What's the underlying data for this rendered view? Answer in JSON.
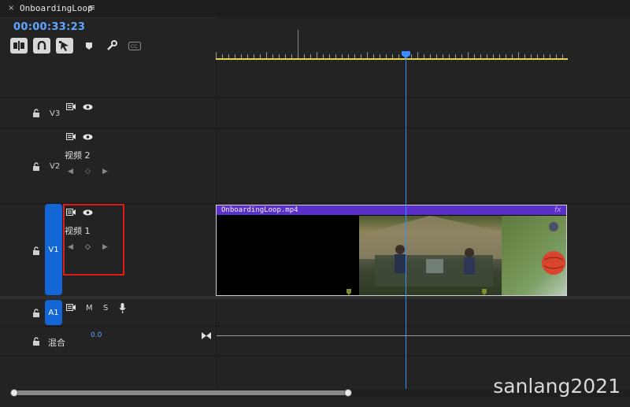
{
  "window": {
    "close_glyph": "×",
    "sequence_name": "OnboardingLoop",
    "menu_glyph": "≡"
  },
  "timecode": "00:00:33:23",
  "toolbar": {
    "buttons": [
      "insert-sequence-as-nest",
      "snap",
      "linked-selection"
    ],
    "icons": [
      "marker-icon",
      "wrench-icon",
      "captions-icon"
    ]
  },
  "tracks": {
    "v3": {
      "label": "V3"
    },
    "v2": {
      "label": "V2",
      "name": "视频 2"
    },
    "v1": {
      "label": "V1",
      "name": "视频 1"
    },
    "a1": {
      "label": "A1",
      "mute": "M",
      "solo": "S"
    },
    "mix": {
      "label": "混合",
      "volume": "0.0"
    }
  },
  "keyframe_nav": {
    "prev": "◀",
    "add": "◇",
    "next": "▶"
  },
  "clip": {
    "name": "OnboardingLoop.mp4",
    "fx": "fx"
  },
  "watermark": "sanlang2021",
  "colors": {
    "accent_blue": "#1366d6",
    "playhead": "#3a8dff",
    "clip_purple": "#5b2fc9",
    "work_area": "#e8d44d",
    "highlight": "#e01b1b"
  }
}
